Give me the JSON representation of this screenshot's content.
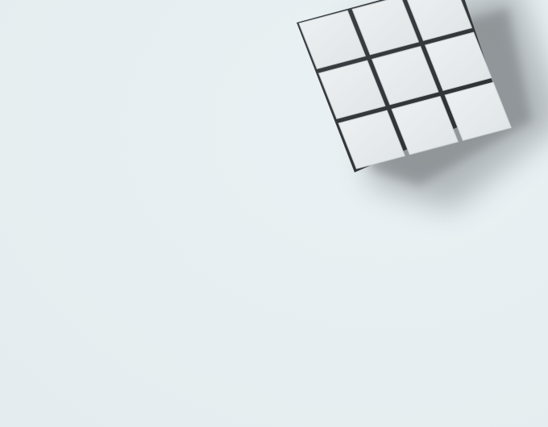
{
  "scene": {
    "subject": "cube-icon",
    "background_color": "#e7eff2",
    "cube_color": "#e4e8ea",
    "shadow_color": "#6f7478"
  }
}
